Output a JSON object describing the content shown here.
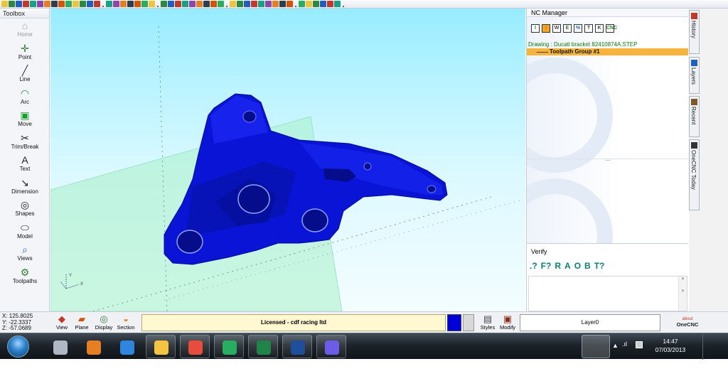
{
  "toolbox": {
    "title": "Toolbox",
    "tools": [
      {
        "label": "Home",
        "icon": "home-icon",
        "enabled": false
      },
      {
        "label": "Point",
        "icon": "point-icon",
        "enabled": true
      },
      {
        "label": "Line",
        "icon": "line-icon",
        "enabled": true
      },
      {
        "label": "Arc",
        "icon": "arc-icon",
        "enabled": true
      },
      {
        "label": "Move",
        "icon": "move-icon",
        "enabled": true
      },
      {
        "label": "Trim/Break",
        "icon": "scissors-icon",
        "enabled": true
      },
      {
        "label": "Text",
        "icon": "text-icon",
        "enabled": true
      },
      {
        "label": "Dimension",
        "icon": "dimension-icon",
        "enabled": true
      },
      {
        "label": "Shapes",
        "icon": "shapes-icon",
        "enabled": true
      },
      {
        "label": "Model",
        "icon": "model-icon",
        "enabled": true
      },
      {
        "label": "Views",
        "icon": "magnifier-icon",
        "enabled": true
      },
      {
        "label": "Toolpaths",
        "icon": "toolpaths-icon",
        "enabled": true
      }
    ]
  },
  "viewport": {
    "axis_x": "X",
    "axis_y": "Y",
    "part_color": "#0a14d6",
    "plane_color": "#a8f0c8"
  },
  "nc_manager": {
    "title": "NC Manager",
    "drawing": "Drawing : Ducati bracket 82410874A.STEP",
    "group": "Toolpath Group #1",
    "splitter": "....",
    "icons": [
      "I",
      "3",
      "W",
      "E",
      "%",
      "T",
      "K",
      "CNC"
    ]
  },
  "verify": {
    "title": "Verify",
    "icons": [
      ".?",
      "F?",
      "R",
      "A",
      "O",
      "B",
      "T?"
    ]
  },
  "side_tabs": [
    "History",
    "Layers",
    "Recent",
    "OneCNC Today"
  ],
  "status": {
    "x": "X: 125.8025",
    "y": "Y: -22.3337",
    "z": "Z: -57.0689",
    "view_label": "View",
    "plane_label": "Plane",
    "display_label": "Display",
    "section_label": "Section",
    "license": "Licensed - cdf racing ltd",
    "styles_label": "Styles",
    "modify_label": "Modify",
    "layer": "Layer0",
    "about_small": "about",
    "about_brand": "OneCNC"
  },
  "taskbar": {
    "time": "14:47",
    "date": "07/03/2013",
    "apps": [
      "paint-icon",
      "media-player-icon",
      "internet-explorer-icon",
      "file-explorer-icon",
      "chrome-icon",
      "people-icon",
      "excel-icon",
      "onecnc-icon",
      "paint-brush-icon"
    ]
  },
  "colors": {
    "accent_group": "#f7b43c",
    "drawing_text": "#0b7a0b",
    "license_bg": "#fff8d0",
    "swatch": "#0000d8"
  }
}
